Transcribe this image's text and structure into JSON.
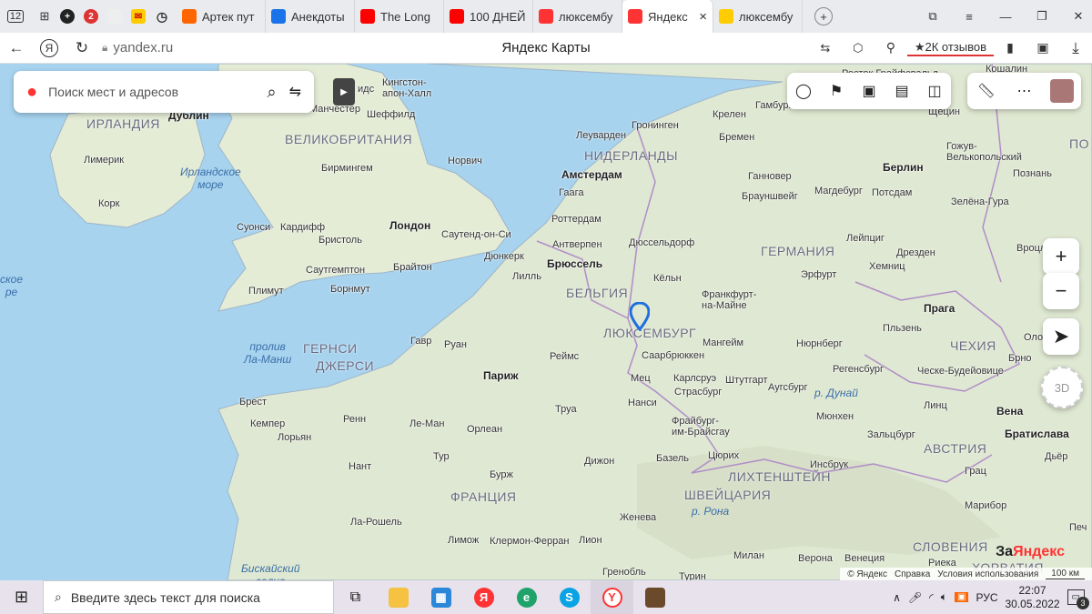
{
  "tabbar": {
    "counter": "12",
    "tabs": [
      {
        "label": "Артек пут",
        "color": "#f60"
      },
      {
        "label": "Анекдоты",
        "color": "#1a73e8"
      },
      {
        "label": "The Long",
        "color": "#f00"
      },
      {
        "label": "100 ДНЕЙ",
        "color": "#f00"
      },
      {
        "label": "люксембу",
        "color": "#f33"
      },
      {
        "label": "Яндекс",
        "color": "#f33",
        "active": true
      },
      {
        "label": "люксембу",
        "color": "#fc0"
      }
    ],
    "close_glyph": "×",
    "new_tab_glyph": "+"
  },
  "addressbar": {
    "url": "yandex.ru",
    "page_title": "Яндекс Карты",
    "reviews": "2К отзывов",
    "reviews_star": "★"
  },
  "search": {
    "placeholder": "Поиск мест и адресов"
  },
  "map": {
    "countries": [
      {
        "label": "ИРЛАНДИЯ"
      },
      {
        "label": "ВЕЛИКОБРИТАНИЯ"
      },
      {
        "label": "НИДЕРЛАНДЫ"
      },
      {
        "label": "ГЕРМАНИЯ"
      },
      {
        "label": "БЕЛЬГИЯ"
      },
      {
        "label": "ФРАНЦИЯ"
      },
      {
        "label": "ШВЕЙЦАРИЯ"
      },
      {
        "label": "ЧЕХИЯ"
      },
      {
        "label": "АВСТРИЯ"
      },
      {
        "label": "ЛИХТЕНШТЕЙН"
      },
      {
        "label": "СЛОВЕНИЯ"
      },
      {
        "label": "ЛЮКСЕМБУРГ"
      },
      {
        "label": "ГЕРНСИ"
      },
      {
        "label": "ДЖЕРСИ"
      },
      {
        "label": "ПО"
      },
      {
        "label": "ХОРВАТИЯ"
      }
    ],
    "cities": [
      {
        "label": "Дублин",
        "big": true
      },
      {
        "label": "Манчестер"
      },
      {
        "label": "Шеффилд"
      },
      {
        "label": "Кингстон-\nапон-Халл"
      },
      {
        "label": "идс"
      },
      {
        "label": "Лимерик"
      },
      {
        "label": "Бирмингем"
      },
      {
        "label": "Норвич"
      },
      {
        "label": "Корк"
      },
      {
        "label": "Суонси"
      },
      {
        "label": "Кардифф"
      },
      {
        "label": "Бристоль"
      },
      {
        "label": "Лондон",
        "big": true
      },
      {
        "label": "Саутенд-он-Си"
      },
      {
        "label": "Саутгемптон"
      },
      {
        "label": "Брайтон"
      },
      {
        "label": "Борнмут"
      },
      {
        "label": "Плимут"
      },
      {
        "label": "Гронинген"
      },
      {
        "label": "Леуварден"
      },
      {
        "label": "Амстердам",
        "big": true
      },
      {
        "label": "Гаага"
      },
      {
        "label": "Роттердам"
      },
      {
        "label": "Антверпен"
      },
      {
        "label": "Брюссель",
        "big": true
      },
      {
        "label": "Дюнкерк"
      },
      {
        "label": "Лилль"
      },
      {
        "label": "Дюссельдорф"
      },
      {
        "label": "Кёльн"
      },
      {
        "label": "Бремен"
      },
      {
        "label": "Гамбург"
      },
      {
        "label": "Крелен"
      },
      {
        "label": "Ганновер"
      },
      {
        "label": "Брауншвейг"
      },
      {
        "label": "Магдебург"
      },
      {
        "label": "Потсдам"
      },
      {
        "label": "Берлин",
        "big": true
      },
      {
        "label": "Щецин"
      },
      {
        "label": "Гожув-\nВелькопольский"
      },
      {
        "label": "Познань"
      },
      {
        "label": "Зелёна-Гура"
      },
      {
        "label": "Лейпциг"
      },
      {
        "label": "Дрезден"
      },
      {
        "label": "Хемниц"
      },
      {
        "label": "Эрфурт"
      },
      {
        "label": "Вроцл"
      },
      {
        "label": "Франкфурт-\nна-Майне"
      },
      {
        "label": "Прага",
        "big": true
      },
      {
        "label": "Пльзень"
      },
      {
        "label": "Оломо"
      },
      {
        "label": "Брно"
      },
      {
        "label": "Мангейм"
      },
      {
        "label": "Нюрнберг"
      },
      {
        "label": "Саарбрюккен"
      },
      {
        "label": "Мец"
      },
      {
        "label": "Карлсруэ"
      },
      {
        "label": "Штутгарт"
      },
      {
        "label": "Страсбург"
      },
      {
        "label": "Нанси"
      },
      {
        "label": "Регенсбург"
      },
      {
        "label": "Ческе-Будейовице"
      },
      {
        "label": "Фрайбург-\nим-Брайсгау"
      },
      {
        "label": "Аугсбург"
      },
      {
        "label": "Мюнхен"
      },
      {
        "label": "Линц"
      },
      {
        "label": "Вена",
        "big": true
      },
      {
        "label": "Братислава",
        "big": true
      },
      {
        "label": "Зальцбург"
      },
      {
        "label": "Базель"
      },
      {
        "label": "Цюрих"
      },
      {
        "label": "Инсбрук"
      },
      {
        "label": "Грац"
      },
      {
        "label": "Марибор"
      },
      {
        "label": "Дьёр"
      },
      {
        "label": "Гавр"
      },
      {
        "label": "Руан"
      },
      {
        "label": "Реймс"
      },
      {
        "label": "Париж",
        "big": true
      },
      {
        "label": "Труа"
      },
      {
        "label": "Брест"
      },
      {
        "label": "Кемпер"
      },
      {
        "label": "Лорьян"
      },
      {
        "label": "Ренн"
      },
      {
        "label": "Ле-Ман"
      },
      {
        "label": "Орлеан"
      },
      {
        "label": "Тур"
      },
      {
        "label": "Нант"
      },
      {
        "label": "Бурж"
      },
      {
        "label": "Дижон"
      },
      {
        "label": "Ла-Рошель"
      },
      {
        "label": "Лимож"
      },
      {
        "label": "Клермон-Ферран"
      },
      {
        "label": "Лион"
      },
      {
        "label": "Женева"
      },
      {
        "label": "Гренобль"
      },
      {
        "label": "Турин"
      },
      {
        "label": "Милан"
      },
      {
        "label": "Верона"
      },
      {
        "label": "Венеция"
      },
      {
        "label": "Риека"
      },
      {
        "label": "Печ"
      },
      {
        "label": "Кошалин"
      },
      {
        "label": "Росток  Грайфсвальд"
      }
    ],
    "seas": [
      {
        "label": "Ирландское\nморе"
      },
      {
        "label": "пролив\nЛа-Манш"
      },
      {
        "label": "Бискайский\nзалив"
      },
      {
        "label": "ское\nре"
      },
      {
        "label": "р. Дунай"
      },
      {
        "label": "р. Рона"
      }
    ]
  },
  "controls": {
    "zoom_in": "+",
    "zoom_out": "−",
    "btn_3d": "3D"
  },
  "footer": {
    "copyright": "© Яндекс",
    "help": "Справка",
    "terms": "Условия использования",
    "scale": "100 км",
    "brand_prefix": "За",
    "brand": "Яндекс"
  },
  "taskbar": {
    "search_placeholder": "Введите здесь текст для поиска",
    "lang": "РУС",
    "time": "22:07",
    "date": "30.05.2022",
    "notif_count": "3"
  }
}
